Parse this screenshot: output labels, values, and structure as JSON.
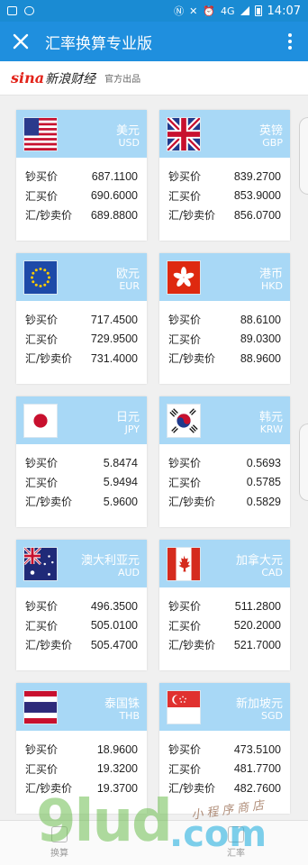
{
  "statusbar": {
    "network": "4G",
    "time": "14:07"
  },
  "titlebar": {
    "title": "汇率换算专业版"
  },
  "brand": {
    "logo_sina": "sina",
    "logo_name": "新浪财经",
    "tagline": "官方出品"
  },
  "labels": {
    "cash_buy": "钞买价",
    "spot_buy": "汇买价",
    "sell": "汇/钞卖价"
  },
  "currencies": [
    {
      "name": "美元",
      "code": "USD",
      "flag": "us-flag-icon",
      "cash_buy": "687.1100",
      "spot_buy": "690.6000",
      "sell": "689.8800"
    },
    {
      "name": "英镑",
      "code": "GBP",
      "flag": "uk-flag-icon",
      "cash_buy": "839.2700",
      "spot_buy": "853.9000",
      "sell": "856.0700"
    },
    {
      "name": "欧元",
      "code": "EUR",
      "flag": "eu-flag-icon",
      "cash_buy": "717.4500",
      "spot_buy": "729.9500",
      "sell": "731.4000"
    },
    {
      "name": "港币",
      "code": "HKD",
      "flag": "hk-flag-icon",
      "cash_buy": "88.6100",
      "spot_buy": "89.0300",
      "sell": "88.9600"
    },
    {
      "name": "日元",
      "code": "JPY",
      "flag": "jp-flag-icon",
      "cash_buy": "5.8474",
      "spot_buy": "5.9494",
      "sell": "5.9600"
    },
    {
      "name": "韩元",
      "code": "KRW",
      "flag": "kr-flag-icon",
      "cash_buy": "0.5693",
      "spot_buy": "0.5785",
      "sell": "0.5829"
    },
    {
      "name": "澳大利亚元",
      "code": "AUD",
      "flag": "au-flag-icon",
      "cash_buy": "496.3500",
      "spot_buy": "505.0100",
      "sell": "505.4700"
    },
    {
      "name": "加拿大元",
      "code": "CAD",
      "flag": "ca-flag-icon",
      "cash_buy": "511.2800",
      "spot_buy": "520.2000",
      "sell": "521.7000"
    },
    {
      "name": "泰国铢",
      "code": "THB",
      "flag": "th-flag-icon",
      "cash_buy": "18.9600",
      "spot_buy": "19.3200",
      "sell": "19.3700"
    },
    {
      "name": "新加坡元",
      "code": "SGD",
      "flag": "sg-flag-icon",
      "cash_buy": "473.5100",
      "spot_buy": "481.7700",
      "sell": "482.7600"
    }
  ],
  "bottom_tabs": {
    "left": "换算",
    "right": "汇率"
  },
  "watermark": {
    "logo": "9lud",
    "domain": ".com",
    "text": "小程序商店"
  }
}
